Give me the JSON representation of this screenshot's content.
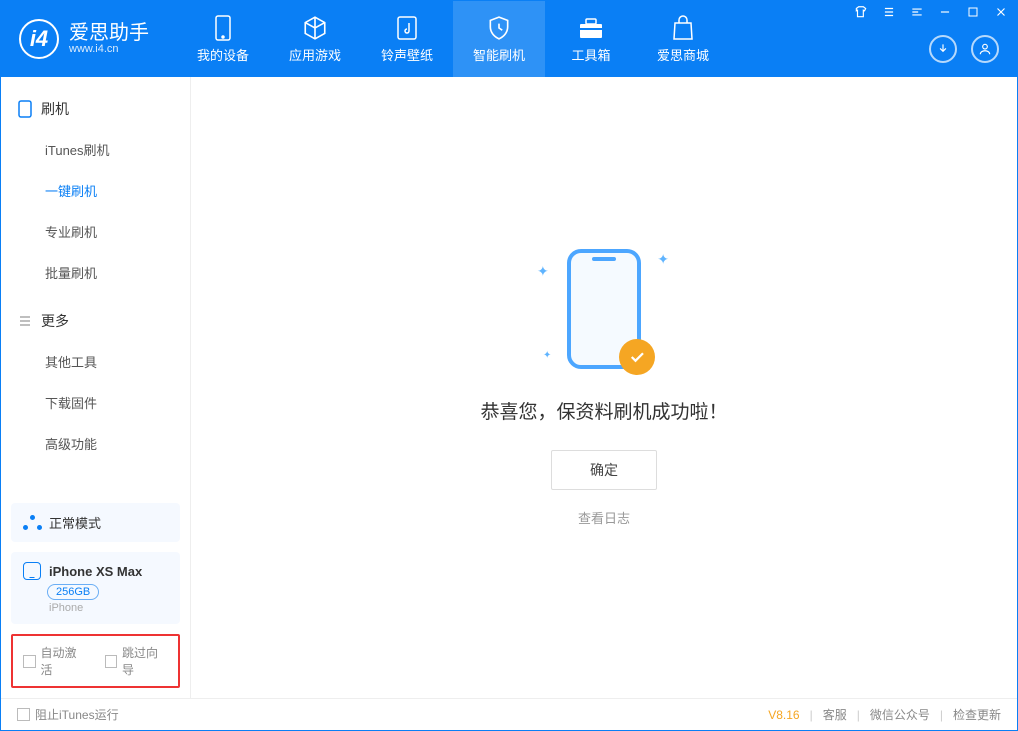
{
  "app": {
    "title": "爱思助手",
    "subtitle": "www.i4.cn"
  },
  "nav": [
    {
      "label": "我的设备"
    },
    {
      "label": "应用游戏"
    },
    {
      "label": "铃声壁纸"
    },
    {
      "label": "智能刷机"
    },
    {
      "label": "工具箱"
    },
    {
      "label": "爱思商城"
    }
  ],
  "sidebar": {
    "section1_title": "刷机",
    "section1_items": [
      {
        "label": "iTunes刷机"
      },
      {
        "label": "一键刷机"
      },
      {
        "label": "专业刷机"
      },
      {
        "label": "批量刷机"
      }
    ],
    "section2_title": "更多",
    "section2_items": [
      {
        "label": "其他工具"
      },
      {
        "label": "下载固件"
      },
      {
        "label": "高级功能"
      }
    ],
    "mode": "正常模式",
    "device_name": "iPhone XS Max",
    "device_storage": "256GB",
    "device_type": "iPhone",
    "option_auto_activate": "自动激活",
    "option_skip_guide": "跳过向导"
  },
  "main": {
    "success_text": "恭喜您，保资料刷机成功啦！",
    "confirm_label": "确定",
    "log_link": "查看日志"
  },
  "footer": {
    "block_itunes": "阻止iTunes运行",
    "version": "V8.16",
    "service": "客服",
    "wechat": "微信公众号",
    "update": "检查更新"
  }
}
